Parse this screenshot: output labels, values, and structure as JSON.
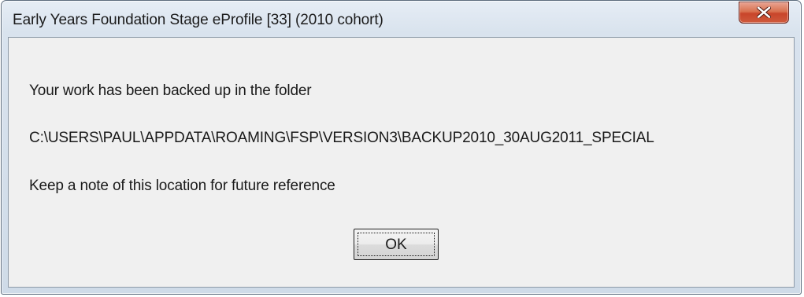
{
  "window": {
    "title": "Early Years Foundation Stage eProfile [33] (2010 cohort)",
    "close_icon": "close-x-icon"
  },
  "message": {
    "line1": "Your work has been backed up in the folder",
    "line2": "C:\\USERS\\PAUL\\APPDATA\\ROAMING\\FSP\\VERSION3\\BACKUP2010_30AUG2011_SPECIAL",
    "line3": "Keep a note of this location for future reference"
  },
  "buttons": {
    "ok_label": "OK"
  },
  "colors": {
    "close_button": "#c8452a",
    "client_background": "#f0f0f0",
    "frame": "#d9e3ee"
  }
}
